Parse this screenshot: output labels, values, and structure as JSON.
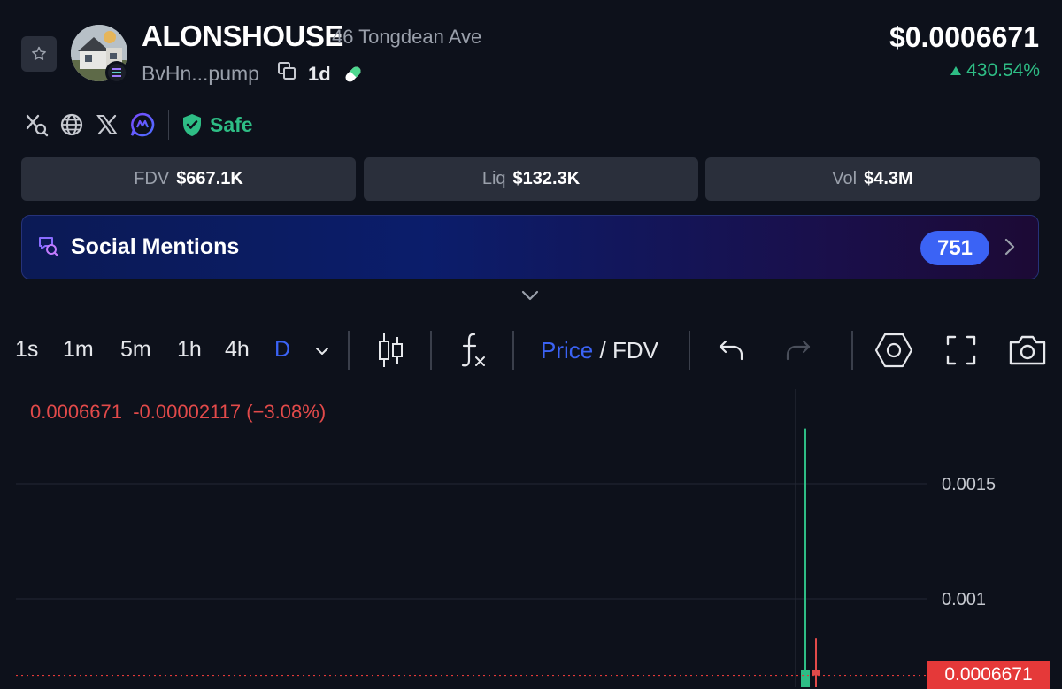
{
  "token": {
    "name": "ALONSHOUSE",
    "subtitle": "46 Tongdean Ave",
    "address": "BvHn...pump",
    "age": "1d",
    "price": "$0.0006671",
    "change": "430.54%",
    "safety_label": "Safe"
  },
  "stats": {
    "fdv_label": "FDV",
    "fdv_value": "$667.1K",
    "liq_label": "Liq",
    "liq_value": "$132.3K",
    "vol_label": "Vol",
    "vol_value": "$4.3M"
  },
  "mentions": {
    "label": "Social Mentions",
    "count": "751"
  },
  "toolbar": {
    "timeframes": [
      "1s",
      "1m",
      "5m",
      "1h",
      "4h",
      "D"
    ],
    "active_timeframe": "D",
    "price_label": "Price",
    "separator": "/",
    "fdv_label": "FDV"
  },
  "chart": {
    "legend_price": "0.0006671",
    "legend_change": "-0.00002117 (−3.08%)",
    "y_ticks": [
      "0.0015",
      "0.001"
    ],
    "current_price_tag": "0.0006671"
  },
  "colors": {
    "up": "#2ebd85",
    "down": "#e24a4a",
    "accent": "#3b63f5",
    "background": "#0d111b"
  },
  "chart_data": {
    "type": "candlestick",
    "candles": [
      {
        "open": 3e-05,
        "high": 0.00174,
        "low": 3e-05,
        "close": 0.00069
      },
      {
        "open": 0.00069,
        "high": 0.00083,
        "low": 0.0006,
        "close": 0.0006671
      }
    ],
    "current_price": 0.0006671
  }
}
